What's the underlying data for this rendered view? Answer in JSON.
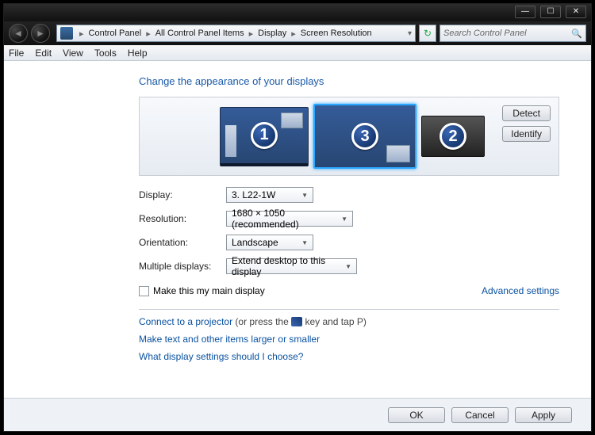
{
  "title_buttons": {
    "min": "—",
    "max": "☐",
    "close": "✕"
  },
  "nav": {
    "back": "◄",
    "forward": "►"
  },
  "breadcrumb": [
    "Control Panel",
    "All Control Panel Items",
    "Display",
    "Screen Resolution"
  ],
  "search_placeholder": "Search Control Panel",
  "menubar": [
    "File",
    "Edit",
    "View",
    "Tools",
    "Help"
  ],
  "heading": "Change the appearance of your displays",
  "side_buttons": {
    "detect": "Detect",
    "identify": "Identify"
  },
  "monitors": {
    "m1": "1",
    "m2": "2",
    "m3": "3"
  },
  "labels": {
    "display": "Display:",
    "resolution": "Resolution:",
    "orientation": "Orientation:",
    "multiple": "Multiple displays:"
  },
  "values": {
    "display": "3. L22-1W",
    "resolution": "1680 × 1050 (recommended)",
    "orientation": "Landscape",
    "multiple": "Extend desktop to this display"
  },
  "main_display_checkbox": "Make this my main display",
  "advanced": "Advanced settings",
  "projector": {
    "link": "Connect to a projector",
    "rest": " (or press the ",
    "tail": " key and tap P)"
  },
  "larger": "Make text and other items larger or smaller",
  "which": "What display settings should I choose?",
  "buttons": {
    "ok": "OK",
    "cancel": "Cancel",
    "apply": "Apply"
  }
}
